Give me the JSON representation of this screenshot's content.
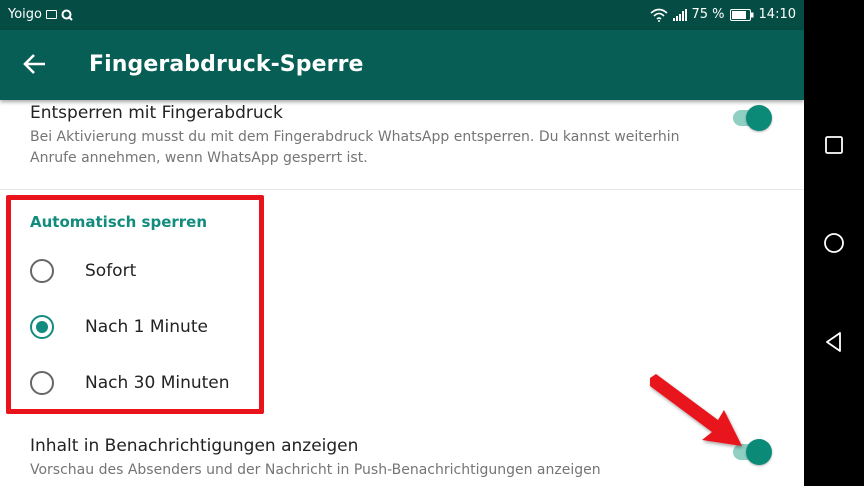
{
  "status_bar": {
    "carrier": "Yoigo",
    "battery_text": "75 %",
    "time": "14:10",
    "background": "#054d44"
  },
  "app_bar": {
    "title": "Fingerabdruck-Sperre",
    "back_icon": "arrow-left-icon",
    "background": "#075e54"
  },
  "settings": {
    "unlock": {
      "title": "Entsperren mit Fingerabdruck",
      "subtitle": "Bei Aktivierung musst du mit dem Fingerabdruck WhatsApp entsperren. Du kannst weiterhin Anrufe annehmen, wenn WhatsApp gesperrt ist.",
      "enabled": true
    },
    "auto_lock": {
      "header": "Automatisch sperren",
      "options": [
        {
          "label": "Sofort",
          "selected": false
        },
        {
          "label": "Nach 1 Minute",
          "selected": true
        },
        {
          "label": "Nach 30 Minuten",
          "selected": false
        }
      ]
    },
    "notifications": {
      "title": "Inhalt in Benachrichtigungen anzeigen",
      "subtitle": "Vorschau des Absenders und der Nachricht in Push-Benachrichtigungen anzeigen",
      "enabled": true
    }
  },
  "annotations": {
    "highlight_color": "#e8131b"
  },
  "nav_bar": {
    "buttons": [
      "recents-square-icon",
      "home-circle-icon",
      "back-triangle-icon"
    ]
  },
  "accent": "#128c7e"
}
